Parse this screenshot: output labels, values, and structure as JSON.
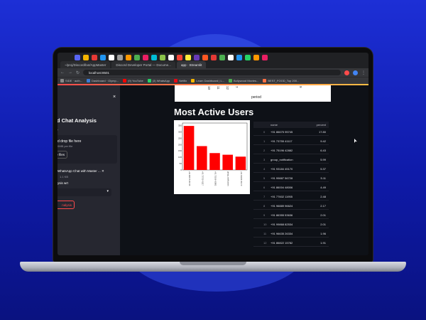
{
  "browser": {
    "tabs": [
      {
        "label": "~/proj/Discord/bot/AppMaster",
        "active": false
      },
      {
        "label": "Discord Developer Portal — Docume...",
        "active": false
      },
      {
        "label": "app · Streamlit",
        "active": true
      }
    ],
    "url": "localhost:8501",
    "bookmarks": [
      {
        "label": "SIDE · auth...",
        "color": "#888888"
      },
      {
        "label": "Dashboard · Olymp...",
        "color": "#3a7bd5"
      },
      {
        "label": "(9) YouTube",
        "color": "#ff0000"
      },
      {
        "label": "(3) WhatsApp",
        "color": "#25d366"
      },
      {
        "label": "Netflix",
        "color": "#e50914"
      },
      {
        "label": "Learn Dashboard | L...",
        "color": "#f4b400"
      },
      {
        "label": "Bollywood Movies...",
        "color": "#4caf50"
      },
      {
        "label": "BEST_FOOD_Top 200...",
        "color": "#ff7043"
      }
    ],
    "extension_colors": [
      "#5865f2",
      "#f4b400",
      "#e53935",
      "#2196f3",
      "#ffffff",
      "#9e9e9e",
      "#ff9800",
      "#4caf50",
      "#e91e63",
      "#00bcd4",
      "#8bc34a",
      "#ffffff",
      "#f44336",
      "#ffeb3b",
      "#673ab7",
      "#ff5722",
      "#e53935",
      "#4caf50",
      "#ffffff",
      "#2196f3",
      "#25d366",
      "#ff9800",
      "#e91e63"
    ]
  },
  "sidebar": {
    "title": "rd Chat Analysis",
    "upload_label": "e",
    "dropzone_text": "d drop file here",
    "dropzone_sub": "0MB per file",
    "browse_label": "e files",
    "file_name": "WhatsApp Chat with Master ...",
    "file_size": "1.1 KB",
    "close_glyph": "×",
    "select_label": "ysis wrt",
    "analysis_button": "nalysis"
  },
  "main": {
    "strip_ticks": [
      "10",
      "11",
      "12",
      "7",
      "9"
    ],
    "strip_axis_label": "period",
    "section_title": "Most Active Users",
    "table": {
      "headers": [
        "name",
        "percent"
      ],
      "rows": [
        {
          "idx": "0",
          "name": "+91 86675 95745",
          "pct": "17.80"
        },
        {
          "idx": "1",
          "name": "+91 73755 41117",
          "pct": "9.42"
        },
        {
          "idx": "2",
          "name": "+91 75196 42882",
          "pct": "6.43"
        },
        {
          "idx": "3",
          "name": "group_notification",
          "pct": "5.99"
        },
        {
          "idx": "4",
          "name": "+91 93184 45170",
          "pct": "5.37"
        },
        {
          "idx": "5",
          "name": "+91 99887 56728",
          "pct": "5.11"
        },
        {
          "idx": "6",
          "name": "+91 86004 48006",
          "pct": "4.49"
        },
        {
          "idx": "7",
          "name": "+91 77602 11955",
          "pct": "2.48"
        },
        {
          "idx": "8",
          "name": "+91 96889 96624",
          "pct": "2.17"
        },
        {
          "idx": "9",
          "name": "+91 86355 53636",
          "pct": "2.01"
        },
        {
          "idx": "10",
          "name": "+91 99868 82534",
          "pct": "2.01"
        },
        {
          "idx": "11",
          "name": "+91 96635 26334",
          "pct": "1.96"
        },
        {
          "idx": "12",
          "name": "+91 86822 15782",
          "pct": "1.91"
        }
      ]
    }
  },
  "chart_data": {
    "type": "bar",
    "categories": [
      "+91 86675 95745",
      "+91 73755 41117",
      "+91 75196 42882",
      "group_notification",
      "+91 93184 45170"
    ],
    "values": [
      347,
      188,
      133,
      120,
      105
    ],
    "ylim": [
      0,
      370
    ],
    "yticks": [
      "0",
      "50",
      "100",
      "150",
      "200",
      "250",
      "300",
      "350"
    ],
    "bar_color": "#ff0000",
    "grid": false
  }
}
